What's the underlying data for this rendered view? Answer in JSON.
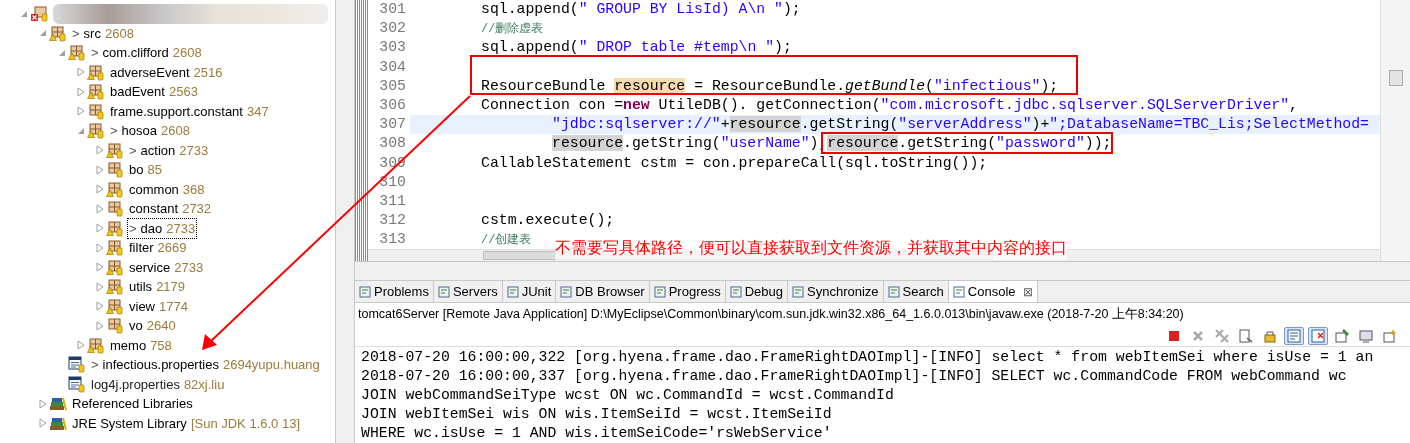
{
  "tree": [
    {
      "kind": "project",
      "expanded": true,
      "children": [
        {
          "kind": "folder",
          "label": "src",
          "marker": ">",
          "info": "2608",
          "expanded": true,
          "warning": true,
          "children": [
            {
              "kind": "package",
              "label": "com.clifford",
              "marker": ">",
              "info": "2608",
              "expanded": true,
              "warning": true,
              "children": [
                {
                  "kind": "package",
                  "label": "adverseEvent",
                  "info": "2516",
                  "expanded": false,
                  "warning": true
                },
                {
                  "kind": "package",
                  "label": "badEvent",
                  "info": "2563",
                  "expanded": false,
                  "warning": true
                },
                {
                  "kind": "package",
                  "label": "frame.support.constant",
                  "info": "347",
                  "expanded": false,
                  "warning": false
                },
                {
                  "kind": "package",
                  "label": "hosoa",
                  "marker": ">",
                  "info": "2608",
                  "expanded": true,
                  "warning": true,
                  "children": [
                    {
                      "kind": "package",
                      "label": "action",
                      "marker": ">",
                      "info": "2733",
                      "expanded": false,
                      "warning": true
                    },
                    {
                      "kind": "package",
                      "label": "bo",
                      "info": "85",
                      "expanded": false,
                      "warning": false
                    },
                    {
                      "kind": "package",
                      "label": "common",
                      "info": "368",
                      "expanded": false,
                      "warning": true
                    },
                    {
                      "kind": "package",
                      "label": "constant",
                      "info": "2732",
                      "expanded": false,
                      "warning": false
                    },
                    {
                      "kind": "package",
                      "label": "dao",
                      "marker": ">",
                      "info": "2733",
                      "expanded": false,
                      "warning": true,
                      "selected": true
                    },
                    {
                      "kind": "package",
                      "label": "filter",
                      "info": "2669",
                      "expanded": false,
                      "warning": true
                    },
                    {
                      "kind": "package",
                      "label": "service",
                      "info": "2733",
                      "expanded": false,
                      "warning": true
                    },
                    {
                      "kind": "package",
                      "label": "utils",
                      "info": "2179",
                      "expanded": false,
                      "warning": true
                    },
                    {
                      "kind": "package",
                      "label": "view",
                      "info": "1774",
                      "expanded": false,
                      "warning": true
                    },
                    {
                      "kind": "package",
                      "label": "vo",
                      "info": "2640",
                      "expanded": false,
                      "warning": false
                    }
                  ]
                },
                {
                  "kind": "package",
                  "label": "memo",
                  "info": "758",
                  "expanded": false,
                  "warning": true
                }
              ]
            },
            {
              "kind": "file",
              "label": "infectious.properties",
              "marker": ">",
              "info": "2694yupu.huang"
            },
            {
              "kind": "file",
              "label": "log4j.properties",
              "info": "82xj.liu"
            }
          ]
        },
        {
          "kind": "library",
          "label": "Referenced Libraries",
          "expanded": false
        },
        {
          "kind": "library",
          "label": "JRE System Library",
          "info": "[Sun JDK 1.6.0 13]",
          "expanded": false
        }
      ]
    }
  ],
  "editor": {
    "lines": [
      {
        "number": "301",
        "kind": "statement",
        "tokens": [
          {
            "t": "sql.append(",
            "kind": "text"
          },
          {
            "t": "\" GROUP BY LisId) A\\n \"",
            "kind": "str"
          },
          {
            "t": ");",
            "kind": "text"
          }
        ]
      },
      {
        "number": "302",
        "kind": "statement",
        "tokens": [
          {
            "t": "//删除虚表",
            "kind": "cmt"
          }
        ]
      },
      {
        "number": "303",
        "kind": "statement",
        "tokens": [
          {
            "t": "sql.append(",
            "kind": "text"
          },
          {
            "t": "\" DROP table #temp\\n \"",
            "kind": "str"
          },
          {
            "t": ");",
            "kind": "text"
          }
        ]
      },
      {
        "number": "304"
      },
      {
        "number": "305",
        "kind": "statement",
        "tokens": [
          {
            "t": "ResourceBundle ",
            "kind": "text"
          },
          {
            "t": "resource",
            "kind": "decl"
          },
          {
            "t": " = ResourceBundle.",
            "kind": "text"
          },
          {
            "t": "getBundle",
            "kind": "ital"
          },
          {
            "t": "(",
            "kind": "text"
          },
          {
            "t": "\"infectious\"",
            "kind": "str"
          },
          {
            "t": ");",
            "kind": "text"
          }
        ]
      },
      {
        "number": "306",
        "kind": "statement",
        "tokens": [
          {
            "t": "Connection con =",
            "kind": "text"
          },
          {
            "t": "new",
            "kind": "kw"
          },
          {
            "t": " UtileDB(). getConnection(",
            "kind": "text"
          },
          {
            "t": "\"com.microsoft.jdbc.sqlserver.SQLServerDriver\"",
            "kind": "str"
          },
          {
            "t": ",",
            "kind": "text"
          }
        ]
      },
      {
        "number": "307",
        "kind": "continuation",
        "current": true,
        "tokens": [
          {
            "t": "\"jdbc:sqlserver://\"",
            "kind": "str"
          },
          {
            "t": "+",
            "kind": "text"
          },
          {
            "t": "resource",
            "kind": "occ"
          },
          {
            "t": ".getString(",
            "kind": "text"
          },
          {
            "t": "\"serverAddress\"",
            "kind": "str"
          },
          {
            "t": ")+",
            "kind": "text"
          },
          {
            "t": "\";DatabaseName=TBC_Lis;SelectMethod=",
            "kind": "str"
          }
        ]
      },
      {
        "number": "308",
        "kind": "continuation",
        "tokens": [
          {
            "t": "resource",
            "kind": "occ"
          },
          {
            "t": ".getString(",
            "kind": "text"
          },
          {
            "t": "\"userName\"",
            "kind": "str"
          },
          {
            "t": "),",
            "kind": "text"
          },
          {
            "t": "resource",
            "kind": "occ"
          },
          {
            "t": ".getString(",
            "kind": "text"
          },
          {
            "t": "\"password\"",
            "kind": "str"
          },
          {
            "t": "));",
            "kind": "text"
          }
        ]
      },
      {
        "number": "309",
        "kind": "statement",
        "tokens": [
          {
            "t": "CallableStatement cstm = con.prepareCall(sql.toString());",
            "kind": "text"
          }
        ]
      },
      {
        "number": "310"
      },
      {
        "number": "311"
      },
      {
        "number": "312",
        "kind": "statement",
        "tokens": [
          {
            "t": "cstm.execute();",
            "kind": "text"
          }
        ]
      },
      {
        "number": "313",
        "kind": "statement",
        "tokens": [
          {
            "t": "//创建表",
            "kind": "cmt"
          }
        ]
      }
    ]
  },
  "annotation": {
    "note": "不需要写具体路径，便可以直接获取到文件资源，并获取其中内容的接口"
  },
  "console": {
    "tabs": [
      {
        "label": "Problems",
        "selected": false
      },
      {
        "label": "Servers",
        "selected": false
      },
      {
        "label": "JUnit",
        "selected": false
      },
      {
        "label": "DB Browser",
        "selected": false
      },
      {
        "label": "Progress",
        "selected": false
      },
      {
        "label": "Debug",
        "selected": false
      },
      {
        "label": "Synchronize",
        "selected": false
      },
      {
        "label": "Search",
        "selected": false
      },
      {
        "label": "Console",
        "selected": true
      }
    ],
    "close": "⊠",
    "process": "tomcat6Server [Remote Java Application] D:\\MyEclipse\\Common\\binary\\com.sun.jdk.win32.x86_64_1.6.0.013\\bin\\javaw.exe (2018-7-20 上午8:34:20)",
    "toolbar": [
      {
        "kind": "stop",
        "pressed": false
      },
      {
        "kind": "remove",
        "pressed": false
      },
      {
        "kind": "remove-all",
        "pressed": false
      },
      {
        "kind": "clear",
        "pressed": false
      },
      {
        "kind": "lock",
        "pressed": false
      },
      {
        "kind": "scroll-lock",
        "pressed": true
      },
      {
        "kind": "word-wrap",
        "pressed": true
      },
      {
        "kind": "pin",
        "pressed": false
      },
      {
        "kind": "display",
        "pressed": false
      },
      {
        "kind": "open",
        "pressed": false
      }
    ],
    "lines": [
      "2018-07-20 16:00:00,322 [org.hyena.frame.dao.FrameRightDAOImpl]-[INFO] select * from webItemSei where isUse = 1 an",
      "2018-07-20 16:00:00,337 [org.hyena.frame.dao.FrameRightDAOImpl]-[INFO] SELECT wc.CommandCode FROM webCommand wc",
      "JOIN webCommandSeiType wcst ON wc.CommandId = wcst.CommandId",
      "JOIN webItemSei wis ON wis.ItemSeiId = wcst.ItemSeiId",
      "WHERE wc.isUse = 1 AND wis.itemSeiCode='rsWebService'"
    ]
  }
}
